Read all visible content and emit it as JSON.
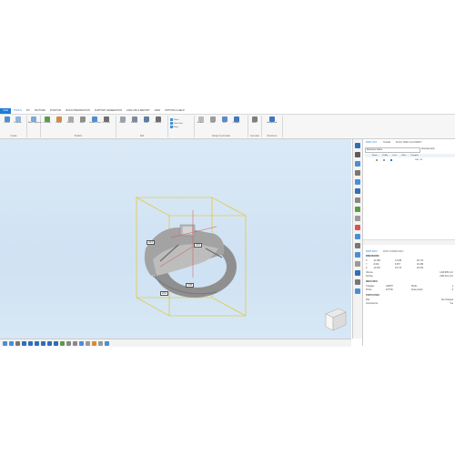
{
  "menu": {
    "file": "FILE",
    "items": [
      "TOOLS",
      "FIX",
      "TEXTURE",
      "POSITION",
      "BUILD PREPARATION",
      "SUPPORT GENERATION",
      "ANALYZE & REPORT",
      "VIEW",
      "OPTIONS & HELP"
    ]
  },
  "ribbon": {
    "groups": [
      {
        "label": "Create",
        "buttons": [
          "Create",
          "Duplicate"
        ]
      },
      {
        "label": "",
        "buttons": [
          "Batch Duplicate"
        ]
      },
      {
        "label": "Position",
        "buttons": [
          "Translate",
          "Rotate",
          "Rescale",
          "Mirror",
          "Position Parts",
          "Cut Parts"
        ]
      },
      {
        "label": "Edit",
        "buttons": [
          "Hollow",
          "Smooth",
          "Fillet",
          "Contour"
        ]
      },
      {
        "label": "",
        "buttons": [
          "Offset",
          "Offset Part",
          "Wrap"
        ]
      },
      {
        "label": "Design & Annotate",
        "buttons": [
          "Emboss",
          "Label",
          "Text",
          "Polygon"
        ]
      },
      {
        "label": "Generate",
        "buttons": [
          "Struct"
        ]
      },
      {
        "label": "Structures",
        "buttons": [
          "Honeycomb"
        ]
      }
    ],
    "small_buttons": [
      "Shrink",
      "Offset",
      "Hollow",
      "Wrap",
      "Wrap fill",
      "Offset Part"
    ]
  },
  "viewport": {
    "dim_x": "24.0",
    "dim_y": "24.0",
    "dim_z": "24.0",
    "dim_center": "0.00"
  },
  "panel": {
    "tabs": [
      "PART LIST",
      "SCENE",
      "BUILD PREP ALIGNMENT"
    ],
    "search_label": "Reference frame",
    "selected_parts_label": "Selected parts",
    "selected_parts_value": "Unit: 1",
    "columns": [
      "Name",
      "Visible",
      "Lock",
      "Color",
      "Triangles"
    ],
    "list_row": {
      "name": "Ring",
      "value": "198 - 93"
    },
    "bottom_tabs": [
      "PART INFO",
      "PART COMMS INFO"
    ],
    "info_title": "DIMENSIONS",
    "dims": [
      {
        "axis": "X",
        "min": "-12.086",
        "max": "14.188",
        "size": "26.712"
      },
      {
        "axis": "Y",
        "min": "-8.232",
        "max": "8.257",
        "size": "16.489"
      },
      {
        "axis": "Z",
        "min": "-11.532",
        "max": "10.173",
        "size": "20.165"
      }
    ],
    "volume_label": "Volume",
    "volume_value": "1319.685 mm³",
    "surface_label": "Surface",
    "surface_value": "2181.321 mm²",
    "mesh_title": "MESH INFO",
    "triangles_label": "Triangles",
    "triangles_value": "148378",
    "points_label": "Points",
    "points_value": "437736",
    "shells_label": "Shells",
    "shells_value": "1",
    "noise_label": "Noise shells",
    "noise_value": "0",
    "status_title": "STATUS INFO",
    "status_label": "Part",
    "status_value": "Not changed",
    "comp_label": "Components",
    "comp_value": "Yes"
  }
}
